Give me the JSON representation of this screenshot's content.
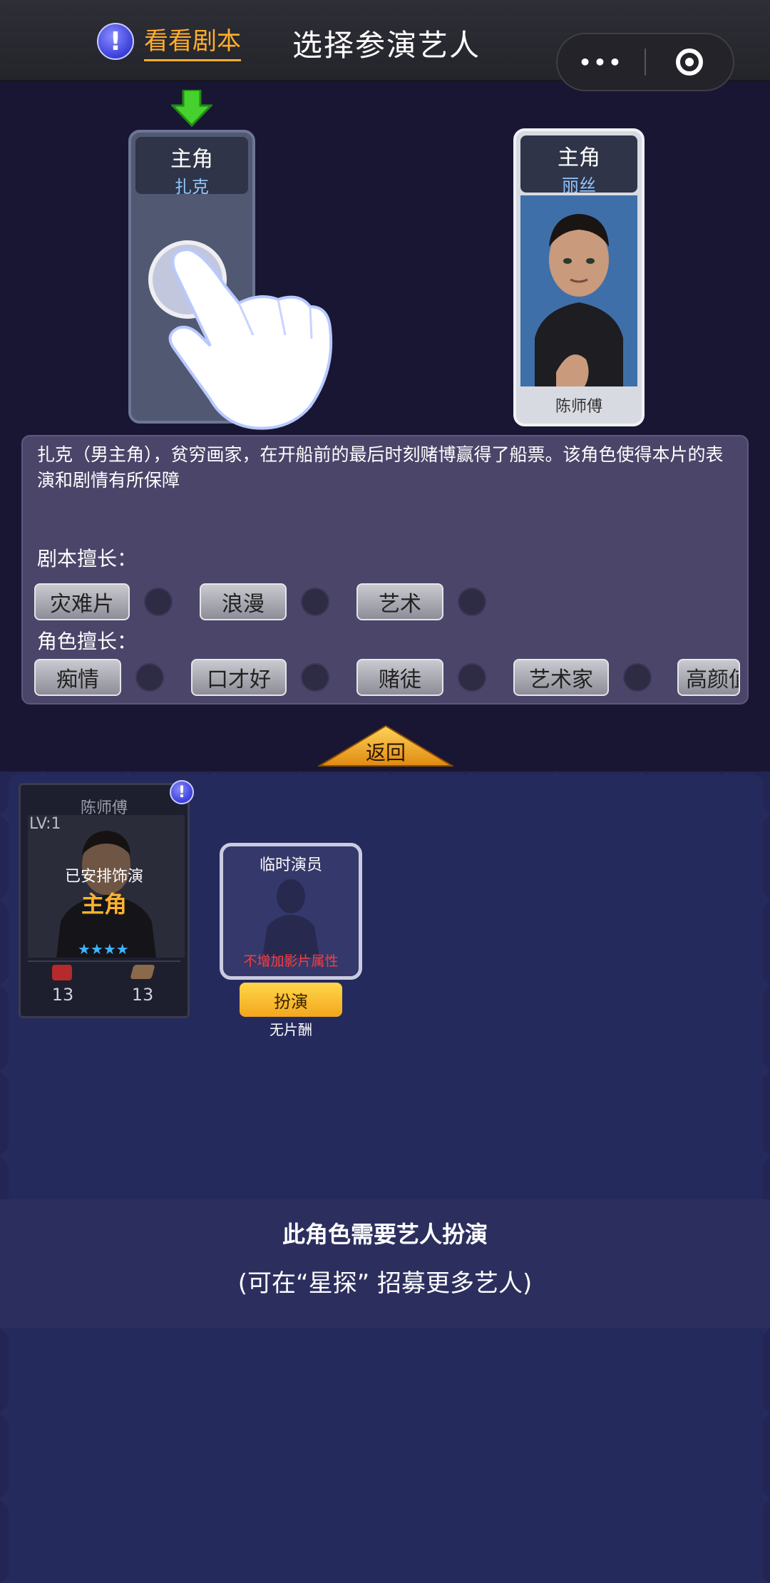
{
  "header": {
    "script_link": "看看剧本",
    "title": "选择参演艺人",
    "menu_icon": "more-dots-icon",
    "close_icon": "target-circle-icon"
  },
  "roles": {
    "left": {
      "role": "主角",
      "character": "扎克"
    },
    "right": {
      "role": "主角",
      "character": "丽丝",
      "actor": "陈师傅"
    }
  },
  "description": {
    "text": "扎克（男主角），贫穷画家，在开船前的最后时刻赌博赢得了船票。该角色使得本片的表演和剧情有所保障",
    "script_skills_label": "剧本擅长：",
    "script_skills": [
      "灾难片",
      "浪漫",
      "艺术"
    ],
    "role_skills_label": "角色擅长：",
    "role_skills": [
      "痴情",
      "口才好",
      "赌徒",
      "艺术家",
      "高颜值"
    ]
  },
  "back_label": "返回",
  "actor_card": {
    "name": "陈师傅",
    "level": "LV:1",
    "status": "已安排饰演",
    "assigned_role": "主角",
    "stat1": "13",
    "stat2": "13"
  },
  "temp_actor": {
    "title": "临时演员",
    "note": "不增加影片属性",
    "button": "扮演",
    "pay": "无片酬"
  },
  "notice": {
    "line1": "此角色需要艺人扮演",
    "line2": "(可在“星探” 招募更多艺人)"
  },
  "colors": {
    "accent": "#ffae2b",
    "panel": "#4a4569",
    "background": "#191634"
  }
}
